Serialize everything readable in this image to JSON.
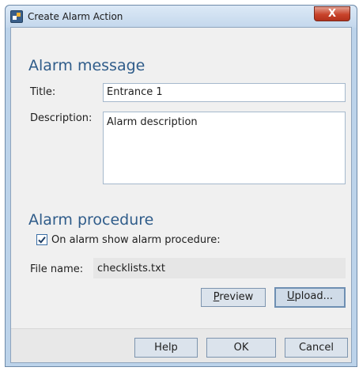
{
  "window": {
    "title": "Create Alarm Action",
    "close_glyph": "X"
  },
  "alarm_message": {
    "heading": "Alarm message",
    "title_label": "Title:",
    "title_value": "Entrance 1",
    "description_label": "Description:",
    "description_value": "Alarm description"
  },
  "alarm_procedure": {
    "heading": "Alarm procedure",
    "checkbox_label": "On alarm show alarm procedure:",
    "checkbox_checked": true,
    "file_label": "File name:",
    "file_value": "checklists.txt",
    "preview_accel": "P",
    "preview_rest": "review",
    "upload_accel": "U",
    "upload_rest": "pload..."
  },
  "footer": {
    "help_label": "Help",
    "ok_label": "OK",
    "cancel_label": "Cancel"
  },
  "icons": {
    "app": "app-icon",
    "close": "close-icon",
    "check": "checkmark-icon"
  }
}
